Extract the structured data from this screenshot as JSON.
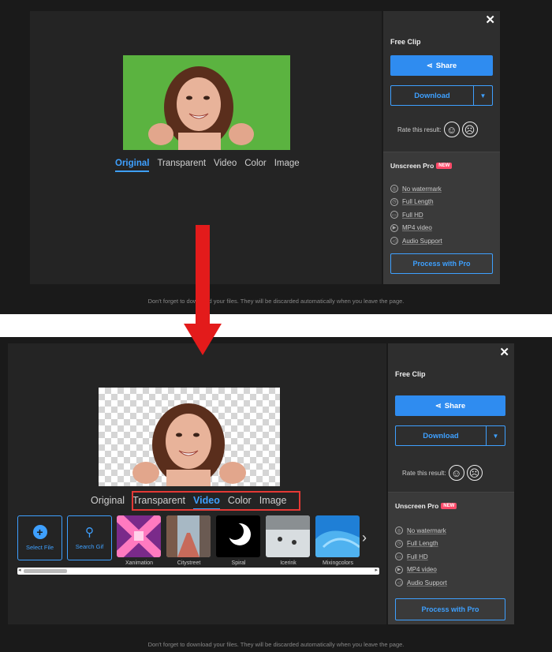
{
  "top_screen": {
    "tabs": [
      {
        "label": "Original",
        "active": true
      },
      {
        "label": "Transparent",
        "active": false
      },
      {
        "label": "Video",
        "active": false
      },
      {
        "label": "Color",
        "active": false
      },
      {
        "label": "Image",
        "active": false
      }
    ],
    "panel": {
      "title": "Free Clip",
      "share_label": "Share",
      "download_label": "Download",
      "rate_label": "Rate this result:",
      "pro_title": "Unscreen Pro",
      "pro_badge": "NEW",
      "features": [
        "No watermark",
        "Full Length",
        "Full HD",
        "MP4 video",
        "Audio Support"
      ],
      "pro_button": "Process with Pro"
    },
    "footer": "Don't forget to download your files. They will be discarded automatically when you leave the page.",
    "preview_background": "#5bb340"
  },
  "bottom_screen": {
    "tabs": [
      {
        "label": "Original",
        "active": false
      },
      {
        "label": "Transparent",
        "active": false
      },
      {
        "label": "Video",
        "active": true
      },
      {
        "label": "Color",
        "active": false
      },
      {
        "label": "Image",
        "active": false
      }
    ],
    "panel": {
      "title": "Free Clip",
      "share_label": "Share",
      "download_label": "Download",
      "rate_label": "Rate this result:",
      "pro_title": "Unscreen Pro",
      "pro_badge": "NEW",
      "features": [
        "No watermark",
        "Full Length",
        "Full HD",
        "MP4 video",
        "Audio Support"
      ],
      "pro_button": "Process with Pro"
    },
    "select_file_label": "Select File",
    "search_gif_label": "Search Gif",
    "backgrounds": [
      {
        "label": "Xanimation",
        "color": "#c0398f"
      },
      {
        "label": "Citystreet",
        "color": "#8a5a4a"
      },
      {
        "label": "Spiral",
        "color": "#000000"
      },
      {
        "label": "Icerink",
        "color": "#c7c7c7"
      },
      {
        "label": "Mixingcolors",
        "color": "#1f7fd6"
      }
    ],
    "footer": "Don't forget to download your files. They will be discarded automatically when you leave the page."
  },
  "accent_color": "#3ea0ff",
  "arrow_color": "#e31b1b"
}
